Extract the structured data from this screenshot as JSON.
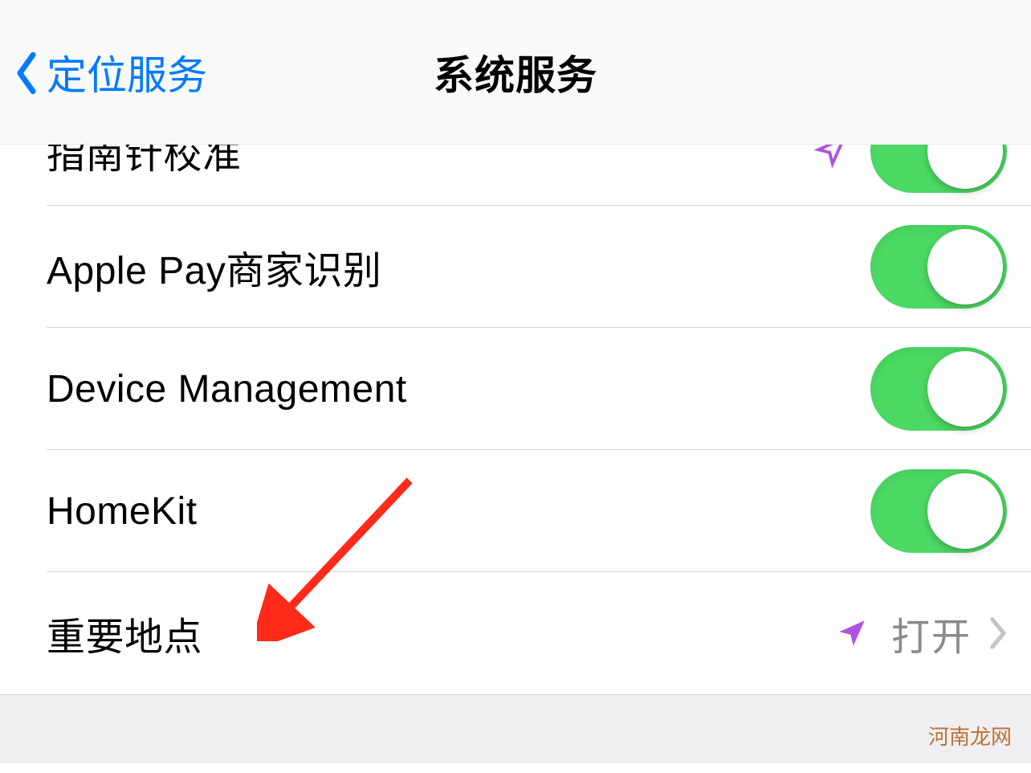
{
  "header": {
    "back_label": "定位服务",
    "title": "系统服务"
  },
  "rows": [
    {
      "label": "指南针校准",
      "type": "toggle",
      "value": true,
      "indicator": "outline"
    },
    {
      "label": "Apple Pay商家识别",
      "type": "toggle",
      "value": true,
      "indicator": null
    },
    {
      "label": "Device Management",
      "type": "toggle",
      "value": true,
      "indicator": null
    },
    {
      "label": "HomeKit",
      "type": "toggle",
      "value": true,
      "indicator": null
    },
    {
      "label": "重要地点",
      "type": "link",
      "value_text": "打开",
      "indicator": "filled"
    }
  ],
  "watermark": "河南龙网",
  "colors": {
    "accent": "#007aff",
    "toggle_on": "#4cd964",
    "indicator": "#af52de",
    "annotation": "#ff2a1a"
  }
}
